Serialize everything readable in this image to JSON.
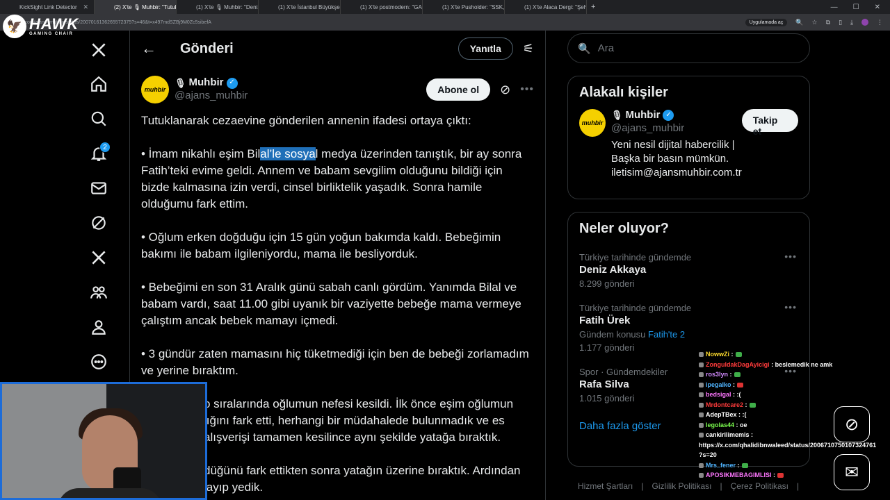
{
  "browser": {
    "tabs": [
      {
        "title": "KickSight Link Detector",
        "active": false
      },
      {
        "title": "(2) X'te 🎙 Muhbir: \"Tutuklan...",
        "active": true
      },
      {
        "title": "(1) X'te 🎙 Muhbir: \"Deniz Akk...",
        "active": false
      },
      {
        "title": "(1) X'te İstanbul Büyükşehir Har...",
        "active": false
      },
      {
        "title": "(1) X'te postmodern: \"GAZZE YA...",
        "active": false
      },
      {
        "title": "(1) X'te Pusholder: \"SSK, Bağ-K...",
        "active": false
      },
      {
        "title": "(1) X'te Alaca Dergi: \"Şehidimiz...",
        "active": false
      }
    ],
    "url": "x.com/ajans_muhbir/status/2007016136265572375?s=46&t=x497mdSZBj9M0Zc5sibefA",
    "translate_label": "Uygulamada aç"
  },
  "overlay": {
    "brand": "HAWK",
    "brand_sub": "GAMING CHAIR"
  },
  "nav": {
    "notifications_badge": "2"
  },
  "header": {
    "title": "Gönderi",
    "reply_label": "Yanıtla"
  },
  "post": {
    "author_name": "Muhbir",
    "author_handle": "@ajans_muhbir",
    "avatar_text": "muhbir",
    "follow_label": "Abone ol",
    "intro": "Tutuklanarak cezaevine gönderilen annenin ifadesi ortaya çıktı:",
    "p1_before": "• İmam nikahlı eşim Bil",
    "p1_highlight": "al’le sosya",
    "p1_after": "l medya üzerinden tanıştık, bir ay sonra Fatih’teki evime geldi. Annem ve babam sevgilim olduğunu bildiği için bizde kalmasına izin verdi, cinsel birliktelik yaşadık. Sonra hamile olduğumu fark ettim.",
    "p2": "• Oğlum erken doğduğu için 15 gün yoğun bakımda kaldı. Bebeğimin bakımı ile babam ilgileniyordu, mama ile besliyorduk.",
    "p3": "• Bebeğimi en son 31 Aralık günü sabah canlı gördüm. Yanımda Bilal ve babam vardı, saat 11.00 gibi uyanık bir vaziyette bebeğe mama vermeye çalıştım ancak bebek mamayı içmedi.",
    "p4": "• 3 gündür zaten mamasını hiç tüketmediği için ben de bebeği zorlamadım ve yerine bıraktım.",
    "p5": "o sıralarında oğlumun nefesi kesildi. İlk önce eşim oğlumun lığını fark etti, herhangi bir müdahalede bulunmadık ve es alışverişi tamamen kesilince aynı şekilde yatağa bıraktık.",
    "p6": "düğünü fark ettikten sonra yatağın üzerine bıraktık. Ardından layıp yedik."
  },
  "search": {
    "placeholder": "Ara"
  },
  "related": {
    "title": "Alakalı kişiler",
    "name": "Muhbir",
    "handle": "@ajans_muhbir",
    "follow_label": "Takip et",
    "bio": "Yeni nesil dijital habercilik | Başka bir basın mümkün. iletisim@ajansmuhbir.com.tr",
    "avatar_text": "muhbir"
  },
  "trends": {
    "title": "Neler oluyor?",
    "items": [
      {
        "category": "Türkiye tarihinde gündemde",
        "name": "Deniz Akkaya",
        "count": "8.299 gönderi"
      },
      {
        "category": "Türkiye tarihinde gündemde",
        "name": "Fatih Ürek",
        "extra_prefix": "Gündem konusu",
        "extra_link": "Fatih'te 2",
        "count": "1.177 gönderi"
      },
      {
        "category": "Spor · Gündemdekiler",
        "name": "Rafa Silva",
        "count": "1.015 gönderi"
      }
    ],
    "show_more": "Daha fazla göster"
  },
  "footer": {
    "terms": "Hizmet Şartları",
    "privacy": "Gizlilik Politikası",
    "cookies": "Çerez Politikası"
  },
  "chat": [
    {
      "user": "NowwZi",
      "msg": ":",
      "color": "#ffdc2e",
      "emote": "#3fae49"
    },
    {
      "user": "ZonguldakDagAyicigi",
      "msg": ": beslemedik ne amk",
      "color": "#ff3b3b",
      "emote": ""
    },
    {
      "user": "ros3lyn",
      "msg": ":",
      "color": "#d28bff",
      "emote": "#3fae49"
    },
    {
      "user": "ipegalko",
      "msg": ":",
      "color": "#4fb4ff",
      "emote": "#d33"
    },
    {
      "user": "bedsigal",
      "msg": ": :(",
      "color": "#ff77ff",
      "emote": ""
    },
    {
      "user": "Mrdontcare2",
      "msg": ":",
      "color": "#ff3b3b",
      "emote": "#3fae49"
    },
    {
      "user": "AdepTBex",
      "msg": ": :(",
      "color": "#ffffff",
      "emote": ""
    },
    {
      "user": "legolas44",
      "msg": ": oe",
      "color": "#7cff4f",
      "emote": ""
    },
    {
      "user": "cankirilimemis",
      "msg": ":",
      "color": "#ffffff",
      "emote": ""
    },
    {
      "user": "",
      "msg": "https://x.com/qhalidibnwaleed/status/2006710750107324761",
      "color": "#ffffff",
      "emote": ""
    },
    {
      "user": "",
      "msg": "?s=20",
      "color": "#ffffff",
      "emote": ""
    },
    {
      "user": "Mrs_fener",
      "msg": ":",
      "color": "#4fb4ff",
      "emote": "#3fae49"
    },
    {
      "user": "APOSIKMEBAGIMLISI",
      "msg": ":",
      "color": "#ff77ff",
      "emote": "#d33"
    }
  ]
}
